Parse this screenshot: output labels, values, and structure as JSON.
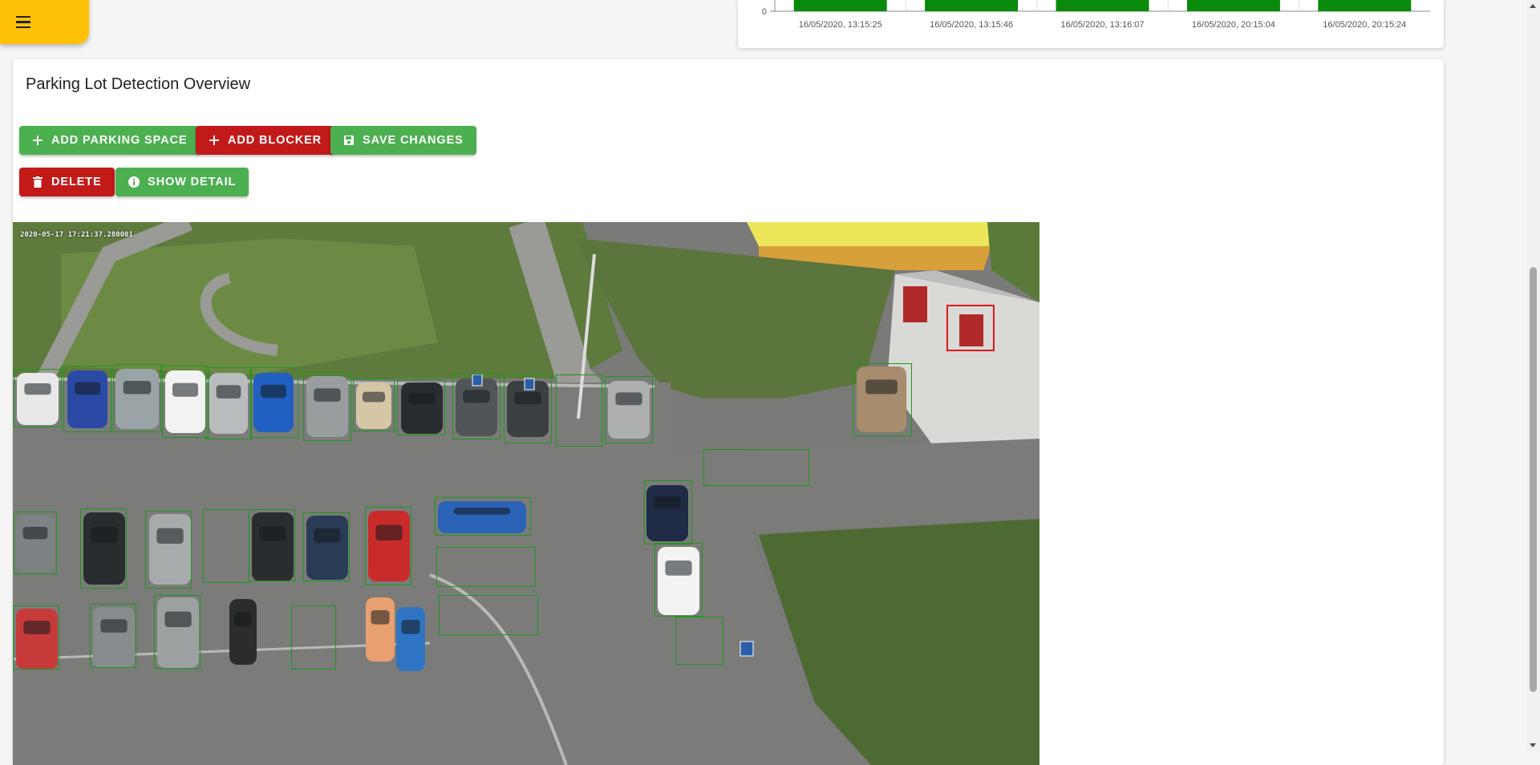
{
  "menu": {
    "icon": "menu-icon"
  },
  "chart_data": {
    "type": "bar",
    "categories": [
      "16/05/2020, 13:15:25",
      "16/05/2020, 13:15:46",
      "16/05/2020, 13:16:07",
      "16/05/2020, 20:15:04",
      "16/05/2020, 20:15:24"
    ],
    "y_tick_visible": "0",
    "bar_color": "#0a8a0a"
  },
  "card": {
    "title": "Parking Lot Detection Overview"
  },
  "toolbar": {
    "add_parking_space": "ADD PARKING SPACE",
    "add_blocker": "ADD BLOCKER",
    "save_changes": "SAVE CHANGES",
    "delete": "DELETE",
    "show_detail": "SHOW DETAIL"
  },
  "colors": {
    "green": "#4caf50",
    "red": "#c21919",
    "accent": "#ffc107"
  },
  "camera": {
    "timestamp": "2020-05-17 17:21:37.280001"
  }
}
